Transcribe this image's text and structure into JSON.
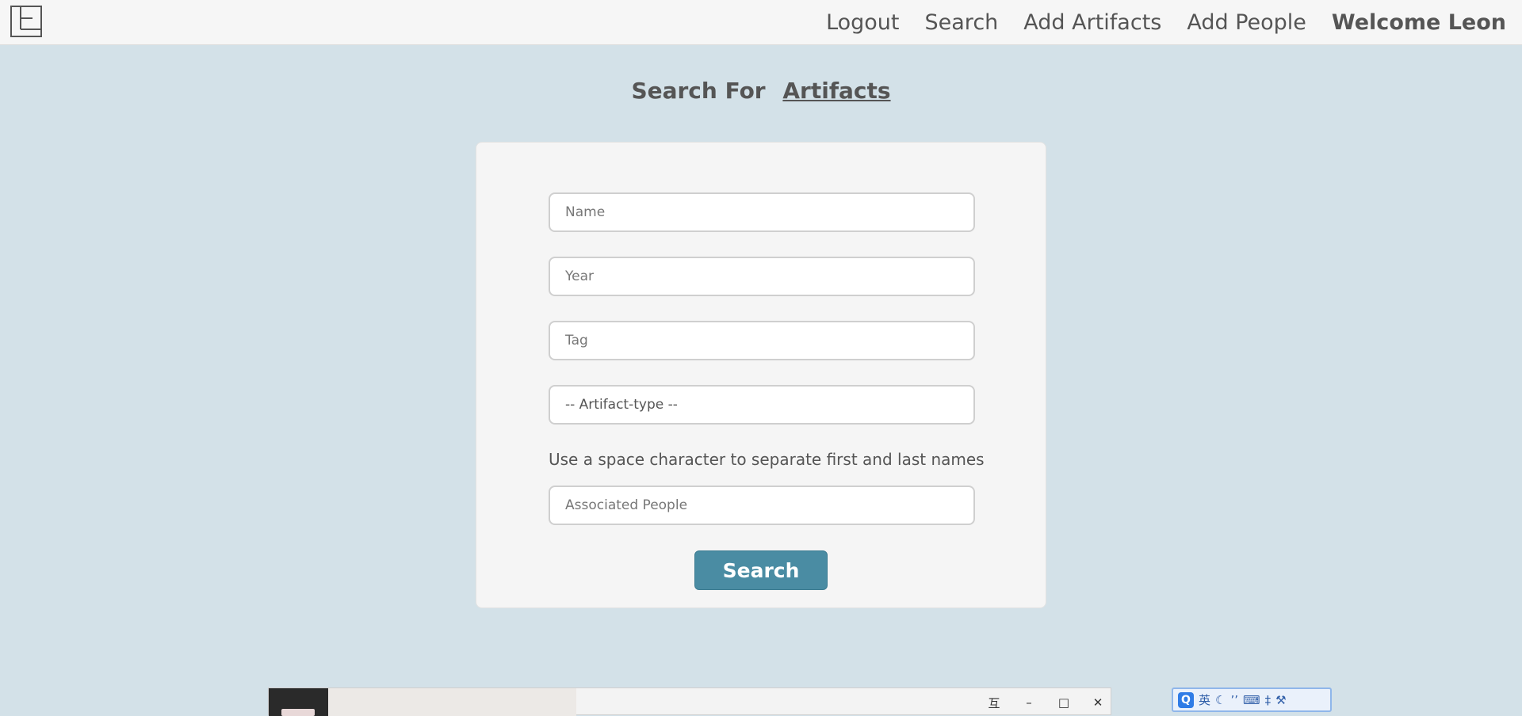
{
  "nav": {
    "logout": "Logout",
    "search": "Search",
    "add_artifacts": "Add Artifacts",
    "add_people": "Add People",
    "welcome": "Welcome Leon"
  },
  "heading": {
    "prefix": "Search For",
    "link": "Artifacts"
  },
  "form": {
    "name_placeholder": "Name",
    "year_placeholder": "Year",
    "tag_placeholder": "Tag",
    "artifact_type_selected": "-- Artifact-type --",
    "hint": "Use a space character to separate first and last names",
    "people_placeholder": "Associated People",
    "search_label": "Search"
  },
  "taskbar": {
    "pin": "互",
    "minimize": "–",
    "maximize": "□",
    "close": "✕"
  },
  "ime": {
    "logo": "Q",
    "lang": "英",
    "moon": "☾",
    "punct": "’’",
    "keyboard": "⌨",
    "split": "‡",
    "wrench": "⚒"
  },
  "colors": {
    "background": "#d3e1e8",
    "button": "#4a8ca3"
  }
}
